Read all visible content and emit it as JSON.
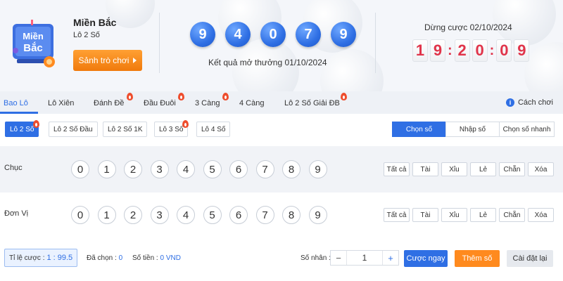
{
  "header": {
    "logo_text_top": "Miền",
    "logo_text_bottom": "Bắc",
    "game_name": "Miền Bắc",
    "game_type": "Lô 2 Số",
    "lobby_button": "Sảnh trò chơi",
    "result_numbers": [
      "9",
      "4",
      "0",
      "7",
      "9"
    ],
    "result_date_text": "Kết quả mở thưởng 01/10/2024",
    "stop_label": "Dừng cược 02/10/2024",
    "countdown": [
      "1",
      "9",
      "2",
      "0",
      "0",
      "9"
    ]
  },
  "tabs": [
    {
      "label": "Bao Lô",
      "hot": false,
      "active": true
    },
    {
      "label": "Lô Xiên",
      "hot": false,
      "active": false
    },
    {
      "label": "Đánh Đề",
      "hot": true,
      "active": false
    },
    {
      "label": "Đầu Đuôi",
      "hot": true,
      "active": false
    },
    {
      "label": "3 Càng",
      "hot": true,
      "active": false
    },
    {
      "label": "4 Càng",
      "hot": false,
      "active": false
    },
    {
      "label": "Lô 2 Số Giải ĐB",
      "hot": true,
      "active": false
    }
  ],
  "guide_label": "Cách chơi",
  "subtabs": [
    {
      "label": "Lô 2 Số",
      "hot": true,
      "active": true
    },
    {
      "label": "Lô 2 Số Đầu",
      "hot": false,
      "active": false
    },
    {
      "label": "Lô 2 Số 1K",
      "hot": false,
      "active": false
    },
    {
      "label": "Lô 3 Số",
      "hot": true,
      "active": false
    },
    {
      "label": "Lô 4 Số",
      "hot": false,
      "active": false
    }
  ],
  "modes": [
    {
      "label": "Chọn số",
      "active": true
    },
    {
      "label": "Nhập số",
      "active": false
    },
    {
      "label": "Chọn số nhanh",
      "active": false
    }
  ],
  "rows": [
    {
      "label": "Chục",
      "numbers": [
        "0",
        "1",
        "2",
        "3",
        "4",
        "5",
        "6",
        "7",
        "8",
        "9"
      ]
    },
    {
      "label": "Đơn Vị",
      "numbers": [
        "0",
        "1",
        "2",
        "3",
        "4",
        "5",
        "6",
        "7",
        "8",
        "9"
      ]
    }
  ],
  "quick_picks": [
    "Tất cả",
    "Tài",
    "Xỉu",
    "Lẻ",
    "Chẵn",
    "Xóa"
  ],
  "footer": {
    "odds_label": "Tỉ lệ cược :",
    "odds_value": "1 : 99.5",
    "selected_label": "Đã chọn :",
    "selected_value": "0",
    "amount_label": "Số tiền :",
    "amount_value": "0 VND",
    "multiplier_label": "Số nhân :",
    "multiplier_value": "1",
    "minus": "−",
    "plus": "+",
    "bet_now": "Cược ngay",
    "add_number": "Thêm số",
    "reset": "Cài đặt lại"
  },
  "colors": {
    "accent": "#2f6fe4",
    "countdown": "#e0344a",
    "orange": "#ff8a1e",
    "hot": "#ee4d2d"
  }
}
